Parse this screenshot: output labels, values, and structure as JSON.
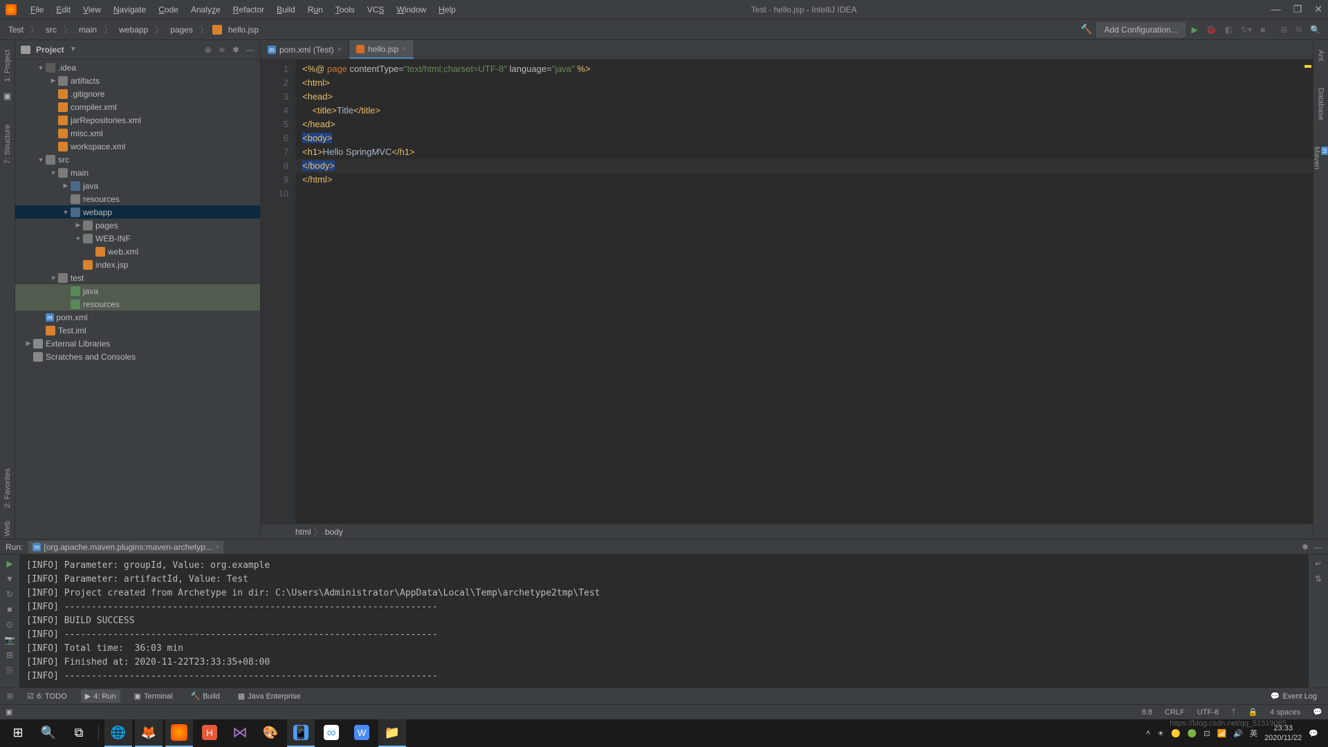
{
  "title": "Test - hello.jsp - IntelliJ IDEA",
  "menu": [
    "File",
    "Edit",
    "View",
    "Navigate",
    "Code",
    "Analyze",
    "Refactor",
    "Build",
    "Run",
    "Tools",
    "VCS",
    "Window",
    "Help"
  ],
  "breadcrumb": [
    "Test",
    "src",
    "main",
    "webapp",
    "pages",
    "hello.jsp"
  ],
  "addConfig": "Add Configuration...",
  "projectTitle": "Project",
  "tree": {
    "idea": ".idea",
    "artifacts": "artifacts",
    "gitignore": ".gitignore",
    "compiler": "compiler.xml",
    "jarRepos": "jarRepositories.xml",
    "misc": "misc.xml",
    "workspace": "workspace.xml",
    "src": "src",
    "main": "main",
    "java": "java",
    "resources": "resources",
    "webapp": "webapp",
    "pages": "pages",
    "webinf": "WEB-INF",
    "webxml": "web.xml",
    "indexjsp": "index.jsp",
    "test": "test",
    "java2": "java",
    "resources2": "resources",
    "pom": "pom.xml",
    "testiml": "Test.iml",
    "extlib": "External Libraries",
    "scratches": "Scratches and Consoles"
  },
  "tabs": {
    "pom": "pom.xml (Test)",
    "hello": "hello.jsp"
  },
  "codeLines": [
    {
      "n": 1,
      "html": "<span class='c-tag'>&lt;%@</span> <span class='c-kw'>page</span> <span class='c-attr'>contentType=</span><span class='c-str'>\"text/html;charset=UTF-8\"</span> <span class='c-attr'>language=</span><span class='c-str'>\"java\"</span> <span class='c-tag'>%&gt;</span>"
    },
    {
      "n": 2,
      "html": "<span class='c-tag'>&lt;html&gt;</span>"
    },
    {
      "n": 3,
      "html": "<span class='c-tag'>&lt;head&gt;</span>"
    },
    {
      "n": 4,
      "html": "    <span class='c-tag'>&lt;title&gt;</span><span class='c-txt'>Title</span><span class='c-tag'>&lt;/title&gt;</span>"
    },
    {
      "n": 5,
      "html": "<span class='c-tag'>&lt;/head&gt;</span>"
    },
    {
      "n": 6,
      "html": "<span class='c-tag hl-bg'>&lt;body&gt;</span>"
    },
    {
      "n": 7,
      "html": "<span class='c-tag'>&lt;h1&gt;</span><span class='c-txt'>Hello SpringMVC</span><span class='c-tag'>&lt;/h1&gt;</span>"
    },
    {
      "n": 8,
      "html": "<span class='c-tag hl-bg'>&lt;/body&gt;</span>"
    },
    {
      "n": 9,
      "html": "<span class='c-tag'>&lt;/html&gt;</span>"
    },
    {
      "n": 10,
      "html": ""
    }
  ],
  "crumb2": [
    "html",
    "body"
  ],
  "run": {
    "title": "Run:",
    "tab": "[org.apache.maven.plugins:maven-archetyp...",
    "lines": [
      "[INFO] Parameter: groupId, Value: org.example",
      "[INFO] Parameter: artifactId, Value: Test",
      "[INFO] Project created from Archetype in dir: C:\\Users\\Administrator\\AppData\\Local\\Temp\\archetype2tmp\\Test",
      "[INFO] ---------------------------------------------------------------------",
      "[INFO] BUILD SUCCESS",
      "[INFO] ---------------------------------------------------------------------",
      "[INFO] Total time:  36:03 min",
      "[INFO] Finished at: 2020-11-22T23:33:35+08:00",
      "[INFO] ---------------------------------------------------------------------"
    ]
  },
  "bottomTabs": {
    "todo": "6: TODO",
    "run": "4: Run",
    "terminal": "Terminal",
    "build": "Build",
    "je": "Java Enterprise",
    "eventlog": "Event Log"
  },
  "sideTabs": {
    "project": "1: Project",
    "structure": "7: Structure",
    "favorites": "2: Favorites",
    "web": "Web",
    "ant": "Ant",
    "db": "Database",
    "maven": "Maven"
  },
  "status": {
    "pos": "8:8",
    "crlf": "CRLF",
    "enc": "UTF-8",
    "spaces": "4 spaces"
  },
  "taskbar": {
    "time": "23:33",
    "date": "2020/11/22"
  },
  "watermark": "https://blog.csdn.net/qq_51519085"
}
